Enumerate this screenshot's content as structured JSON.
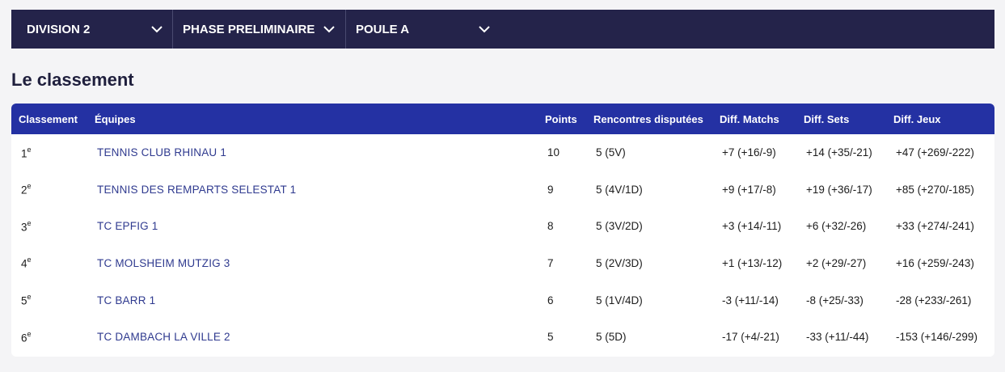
{
  "filters": [
    {
      "label": "DIVISION 2"
    },
    {
      "label": "PHASE PRELIMINAIRE"
    },
    {
      "label": "POULE A"
    }
  ],
  "section_title": "Le classement",
  "table": {
    "headers": [
      "Classement",
      "Équipes",
      "Points",
      "Rencontres disputées",
      "Diff. Matchs",
      "Diff. Sets",
      "Diff. Jeux"
    ],
    "rows": [
      {
        "rank": "1",
        "suffix": "e",
        "team": "TENNIS CLUB RHINAU 1",
        "points": "10",
        "played": "5 (5V)",
        "diff_matchs": "+7 (+16/-9)",
        "diff_sets": "+14 (+35/-21)",
        "diff_jeux": "+47 (+269/-222)"
      },
      {
        "rank": "2",
        "suffix": "e",
        "team": "TENNIS DES REMPARTS SELESTAT 1",
        "points": "9",
        "played": "5 (4V/1D)",
        "diff_matchs": "+9 (+17/-8)",
        "diff_sets": "+19 (+36/-17)",
        "diff_jeux": "+85 (+270/-185)"
      },
      {
        "rank": "3",
        "suffix": "e",
        "team": "TC EPFIG 1",
        "points": "8",
        "played": "5 (3V/2D)",
        "diff_matchs": "+3 (+14/-11)",
        "diff_sets": "+6 (+32/-26)",
        "diff_jeux": "+33 (+274/-241)"
      },
      {
        "rank": "4",
        "suffix": "e",
        "team": "TC MOLSHEIM MUTZIG 3",
        "points": "7",
        "played": "5 (2V/3D)",
        "diff_matchs": "+1 (+13/-12)",
        "diff_sets": "+2 (+29/-27)",
        "diff_jeux": "+16 (+259/-243)"
      },
      {
        "rank": "5",
        "suffix": "e",
        "team": "TC BARR 1",
        "points": "6",
        "played": "5 (1V/4D)",
        "diff_matchs": "-3 (+11/-14)",
        "diff_sets": "-8 (+25/-33)",
        "diff_jeux": "-28 (+233/-261)"
      },
      {
        "rank": "6",
        "suffix": "e",
        "team": "TC DAMBACH LA VILLE 2",
        "points": "5",
        "played": "5 (5D)",
        "diff_matchs": "-17 (+4/-21)",
        "diff_sets": "-33 (+11/-44)",
        "diff_jeux": "-153 (+146/-299)"
      }
    ]
  },
  "colors": {
    "filterbar_bg": "#24234a",
    "table_header_bg": "#2431a3",
    "team_link": "#2f3a8f",
    "title": "#1f1f3d"
  }
}
